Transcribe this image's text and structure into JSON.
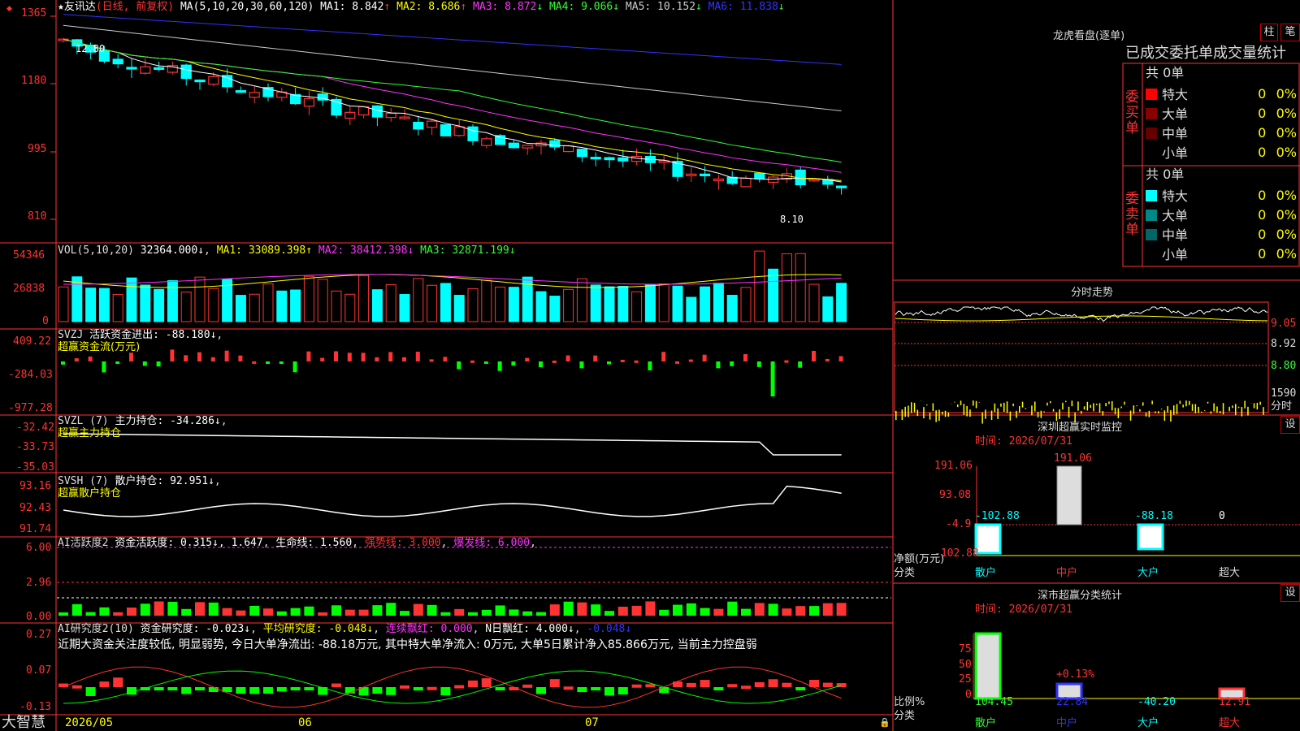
{
  "stock": {
    "title": "★友讯达",
    "period": "(日线, 前复权)",
    "ma_label": "MA(5,10,20,30,60,120)",
    "ma_values": [
      {
        "label": "MA1: 8.842",
        "arrow": "↑",
        "color": "#ffffff"
      },
      {
        "label": "MA2: 8.686",
        "arrow": "↑",
        "color": "#ffff00"
      },
      {
        "label": "MA3: 8.872",
        "arrow": "↓",
        "color": "#ff33ff"
      },
      {
        "label": "MA4: 9.066",
        "arrow": "↓",
        "color": "#33ff33"
      },
      {
        "label": "MA5: 10.152",
        "arrow": "↓",
        "color": "#cccccc"
      },
      {
        "label": "MA6: 11.838",
        "arrow": "↓",
        "color": "#3333ff"
      }
    ],
    "high_label": "12.80",
    "low_label": "8.10"
  },
  "axes": {
    "price": [
      "1365",
      "1180",
      "995",
      "810"
    ],
    "vol": [
      "54346",
      "26838",
      "0"
    ],
    "svzj": [
      "409.22",
      "-284.03",
      "-977.28"
    ],
    "svzl": [
      "-32.42",
      "-33.73",
      "-35.03"
    ],
    "svsh": [
      "93.16",
      "92.43",
      "91.74"
    ],
    "ai1": [
      "6.00",
      "2.96",
      "0.00"
    ],
    "ai2": [
      "0.27",
      "0.07",
      "-0.13"
    ]
  },
  "indicators": {
    "vol": {
      "name": "VOL(5,10,20)",
      "value": "32364.000↓",
      "ma1": "MA1: 33089.398↑",
      "ma2": "MA2: 38412.398↓",
      "ma3": "MA3: 32871.199↓"
    },
    "svzj": {
      "name": "SVZJ",
      "text": "活跃资金进出: -88.180↓",
      "sub": "超赢资金流(万元)"
    },
    "svzl": {
      "name": "SVZL (7)",
      "text": "主力持仓: -34.286↓",
      "sub": "超赢主力持仓"
    },
    "svsh": {
      "name": "SVSH (7)",
      "text": "散户持仓: 92.951↓",
      "sub": "超赢散户持仓"
    },
    "ai1": {
      "name": "AI活跃度2",
      "text": "资金活跃度: 0.315↓, 1.647",
      "life": "生命线: 1.560",
      "strong": "强势线: 3.000",
      "burst": "爆发线: 6.000"
    },
    "ai2": {
      "name": "AI研究度2(10)",
      "text": "资金研究度: -0.023↓",
      "avg": "平均研究度: -0.048↓",
      "red": "连续飘红: 0.000",
      "nred": "N日飘红: 4.000↓",
      "last": "-0.048↓"
    }
  },
  "commentary": "近期大资金关注度较低, 明显弱势, 今日大单净流出: -88.18万元, 其中特大单净流入: 0万元, 大单5日累计净入85.866万元, 当前主力控盘弱",
  "dates": [
    "2026/05",
    "06",
    "07"
  ],
  "brand": "大智慧",
  "right": {
    "dragon_title": "龙虎看盘(逐单)",
    "btn_zhu": "柱",
    "btn_bi": "笔",
    "stats_title": "已成交委托单成交量统计",
    "buy": {
      "side": "委买单",
      "total": "共 0单",
      "rows": [
        {
          "label": "特大",
          "v": "0",
          "p": "0%",
          "color": "#ff0000"
        },
        {
          "label": "大单",
          "v": "0",
          "p": "0%",
          "color": "#880000"
        },
        {
          "label": "中单",
          "v": "0",
          "p": "0%",
          "color": "#660000"
        },
        {
          "label": "小单",
          "v": "0",
          "p": "0%",
          "color": "#000000"
        }
      ]
    },
    "sell": {
      "side": "委卖单",
      "total": "共 0单",
      "rows": [
        {
          "label": "特大",
          "v": "0",
          "p": "0%",
          "color": "#00ffff"
        },
        {
          "label": "大单",
          "v": "0",
          "p": "0%",
          "color": "#008888"
        },
        {
          "label": "中单",
          "v": "0",
          "p": "0%",
          "color": "#006666"
        },
        {
          "label": "小单",
          "v": "0",
          "p": "0%",
          "color": "#000000"
        }
      ]
    },
    "intraday": {
      "title": "分时走势",
      "p1": "9.05",
      "p2": "8.92",
      "p3": "8.80",
      "vol": "1590",
      "unit": "分时"
    },
    "monitor": {
      "title": "深圳超赢实时监控",
      "set": "设",
      "time": "时间: 2026/07/31",
      "ticks": [
        "191.06",
        "93.08",
        "-4.9",
        "-102.88"
      ],
      "top_value": "191.06",
      "values": [
        "-102.88",
        "",
        "-88.18",
        "0"
      ],
      "cats": [
        "散户",
        "中户",
        "大户",
        "超大"
      ],
      "ylabel": "净额(万元)",
      "xlabel": "分类"
    },
    "classify": {
      "title": "深市超赢分类统计",
      "set": "设",
      "time": "时间: 2026/07/31",
      "ticks": [
        "75",
        "50",
        "25",
        "0"
      ],
      "annot": "+0.13%",
      "values": [
        "104.45",
        "22.84",
        "-40.20",
        "12.91"
      ],
      "cats": [
        "散户",
        "中户",
        "大户",
        "超大"
      ],
      "ylabel": "比例%",
      "xlabel": "分类"
    }
  }
}
